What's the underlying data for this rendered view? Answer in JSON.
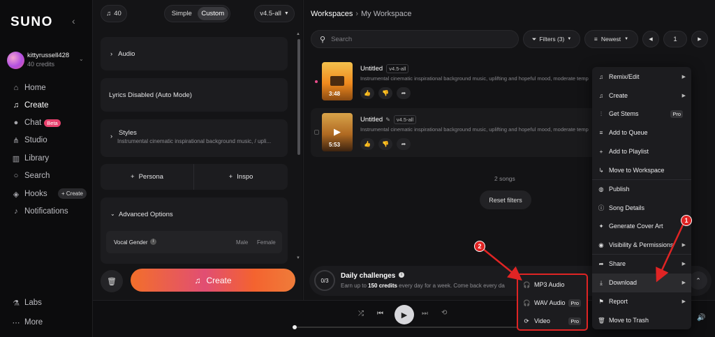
{
  "sidebar": {
    "logo": "SUNO",
    "user": {
      "name": "kittyrussell428",
      "credits": "40 credits"
    },
    "nav": [
      {
        "label": "Home",
        "icon": "home-icon"
      },
      {
        "label": "Create",
        "icon": "music-note-icon"
      },
      {
        "label": "Chat",
        "icon": "chat-icon",
        "badge": "Beta"
      },
      {
        "label": "Studio",
        "icon": "studio-icon"
      },
      {
        "label": "Library",
        "icon": "library-icon"
      },
      {
        "label": "Search",
        "icon": "search-icon"
      },
      {
        "label": "Hooks",
        "icon": "hooks-icon",
        "action": "+ Create"
      },
      {
        "label": "Notifications",
        "icon": "bell-icon"
      }
    ],
    "bottom": [
      {
        "label": "Labs",
        "icon": "flask-icon"
      },
      {
        "label": "More",
        "icon": "more-icon"
      }
    ]
  },
  "create_panel": {
    "credits_count": "40",
    "mode_simple": "Simple",
    "mode_custom": "Custom",
    "model": "v4.5-all",
    "audio_label": "Audio",
    "lyrics_label": "Lyrics Disabled (Auto Mode)",
    "styles_label": "Styles",
    "styles_value": "Instrumental cinematic inspirational background music, / upli...",
    "persona_label": "Persona",
    "inspo_label": "Inspo",
    "advanced_label": "Advanced Options",
    "vocal_gender_label": "Vocal Gender",
    "vocal_male": "Male",
    "vocal_female": "Female",
    "create_button": "Create"
  },
  "workspace": {
    "breadcrumb_root": "Workspaces",
    "breadcrumb_current": "My Workspace",
    "search_placeholder": "Search",
    "filters_label": "Filters (3)",
    "sort_label": "Newest",
    "page_number": "1",
    "songs": [
      {
        "title": "Untitled",
        "version": "v4.5-all",
        "duration": "3:48",
        "description": "Instrumental cinematic inspirational background music, uplifting and hopeful mood, moderate temp"
      },
      {
        "title": "Untitled",
        "version": "v4.5-all",
        "duration": "5:53",
        "description": "Instrumental cinematic inspirational background music, uplifting and hopeful mood, moderate temp"
      }
    ],
    "song_count": "2 songs",
    "reset_filters": "Reset filters"
  },
  "challenges": {
    "progress": "0/3",
    "title": "Daily challenges",
    "desc_prefix": "Earn up to ",
    "desc_bold": "150 credits",
    "desc_suffix": " every day for a week. Come back every da"
  },
  "context_menu": {
    "items": [
      {
        "label": "Remix/Edit",
        "icon": "remix-icon",
        "submenu": true
      },
      {
        "label": "Create",
        "icon": "music-note-icon",
        "submenu": true
      },
      {
        "label": "Get Stems",
        "icon": "stems-icon",
        "pro": "Pro"
      },
      {
        "label": "Add to Queue",
        "icon": "queue-icon"
      },
      {
        "label": "Add to Playlist",
        "icon": "plus-icon"
      },
      {
        "label": "Move to Workspace",
        "icon": "move-icon"
      },
      {
        "label": "Publish",
        "icon": "globe-icon"
      },
      {
        "label": "Song Details",
        "icon": "info-icon"
      },
      {
        "label": "Generate Cover Art",
        "icon": "sparkle-icon"
      },
      {
        "label": "Visibility & Permissions",
        "icon": "eye-icon",
        "submenu": true
      },
      {
        "label": "Share",
        "icon": "share-icon",
        "submenu": true
      },
      {
        "label": "Download",
        "icon": "download-icon",
        "submenu": true
      },
      {
        "label": "Report",
        "icon": "flag-icon",
        "submenu": true
      },
      {
        "label": "Move to Trash",
        "icon": "trash-icon"
      }
    ]
  },
  "download_submenu": {
    "items": [
      {
        "label": "MP3 Audio",
        "icon": "headphones-icon"
      },
      {
        "label": "WAV Audio",
        "icon": "headphones-icon",
        "pro": "Pro"
      },
      {
        "label": "Video",
        "icon": "video-icon",
        "pro": "Pro"
      }
    ]
  },
  "annotations": {
    "badge1": "1",
    "badge2": "2",
    "color": "#e02424"
  }
}
